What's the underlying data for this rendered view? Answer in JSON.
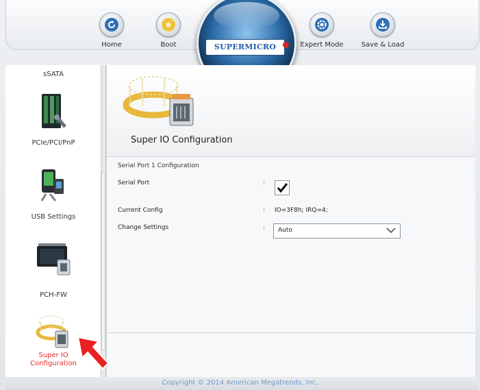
{
  "nav": {
    "home_label": "Home",
    "boot_label": "Boot",
    "expert_label": "Expert Mode",
    "save_label": "Save & Load",
    "logo_text": "SUPERMICRO"
  },
  "sidebar": {
    "items": [
      {
        "label": "sSATA"
      },
      {
        "label": "PCIe/PCI/PnP"
      },
      {
        "label": "USB Settings"
      },
      {
        "label": "PCH-FW"
      },
      {
        "label": "Super IO Configuration",
        "active": true
      }
    ]
  },
  "main": {
    "page_title": "Super IO Configuration",
    "section_title": "Serial Port 1 Configuration",
    "rows": [
      {
        "label": "Serial Port",
        "colon": ":",
        "type": "checkbox",
        "checked": true
      },
      {
        "label": "Current Config",
        "colon": ":",
        "value": "IO=3F8h; IRQ=4;"
      },
      {
        "label": "Change Settings",
        "colon": ":",
        "type": "select",
        "value": "Auto"
      }
    ]
  },
  "footer": {
    "copyright": "Copyright © 2014 American Megatrends, Inc."
  },
  "colors": {
    "accent_active": "#e22929",
    "link_blue": "#6d9ac9"
  }
}
